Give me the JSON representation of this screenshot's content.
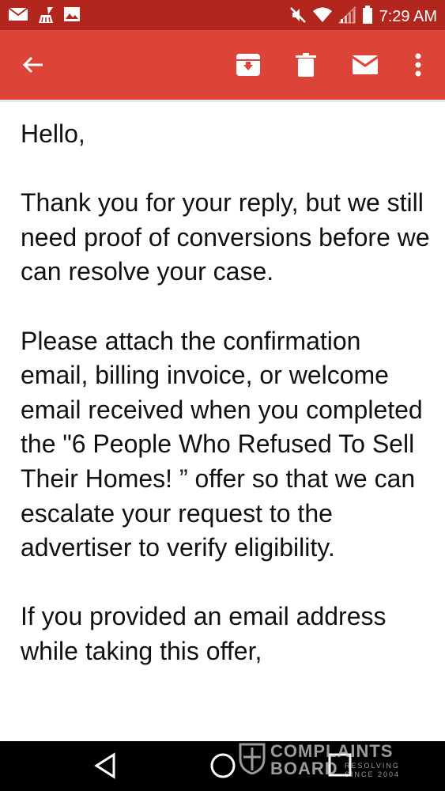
{
  "status_bar": {
    "time": "7:29 AM",
    "left_icons": [
      "mail-icon",
      "clean-brush-icon",
      "image-icon"
    ],
    "right_icons": [
      "mute-icon",
      "wifi-icon",
      "signal-icon",
      "battery-icon"
    ]
  },
  "toolbar": {
    "icons": [
      "back-arrow-icon",
      "archive-icon",
      "delete-icon",
      "mail-icon",
      "more-vert-icon"
    ],
    "bg_color": "#db4437"
  },
  "email": {
    "paragraphs": [
      "Hello,",
      "Thank you for your reply, but we still need proof of conversions before we can resolve your case.",
      "Please attach the confirmation email, billing invoice, or welcome email received when you completed the \"6 People Who Refused To Sell Their Homes! ” offer so that we can escalate your request to the advertiser to verify eligibility.",
      "If you provided an email address while taking this offer,"
    ]
  },
  "nav_bar": {
    "icons": [
      "back-triangle-icon",
      "home-circle-icon",
      "recents-square-icon"
    ]
  },
  "watermark": {
    "line1": "COMPLAINTS",
    "line2": "BOARD",
    "tagline1": "RESOLVING",
    "tagline2": "SINCE 2004"
  }
}
